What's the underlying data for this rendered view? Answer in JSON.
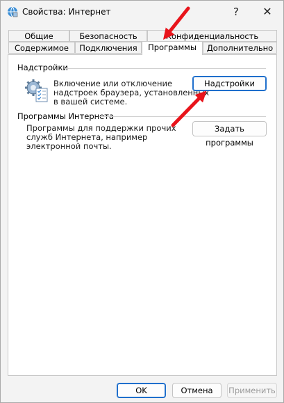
{
  "window": {
    "title": "Свойства: Интернет"
  },
  "titlebar": {
    "help_glyph": "?",
    "close_glyph": "✕"
  },
  "tabs": {
    "row1": [
      "Общие",
      "Безопасность",
      "Конфиденциальность"
    ],
    "row2": [
      "Содержимое",
      "Подключения",
      "Программы",
      "Дополнительно"
    ],
    "active": "Программы"
  },
  "addons": {
    "group_label": "Надстройки",
    "description_lines": [
      "Включение или отключение",
      "надстроек браузера, установленных",
      "в вашей системе."
    ],
    "button_label": "Надстройки"
  },
  "internet_programs": {
    "group_label": "Программы Интернета",
    "description_lines": [
      "Программы для поддержки прочих",
      "служб Интернета, например",
      "электронной почты."
    ],
    "button_label": "Задать программы"
  },
  "footer": {
    "ok_label": "OK",
    "cancel_label": "Отмена",
    "apply_label": "Применить"
  },
  "colors": {
    "accent_border": "#1f6fcc",
    "annotation_arrow": "#e8141b"
  }
}
